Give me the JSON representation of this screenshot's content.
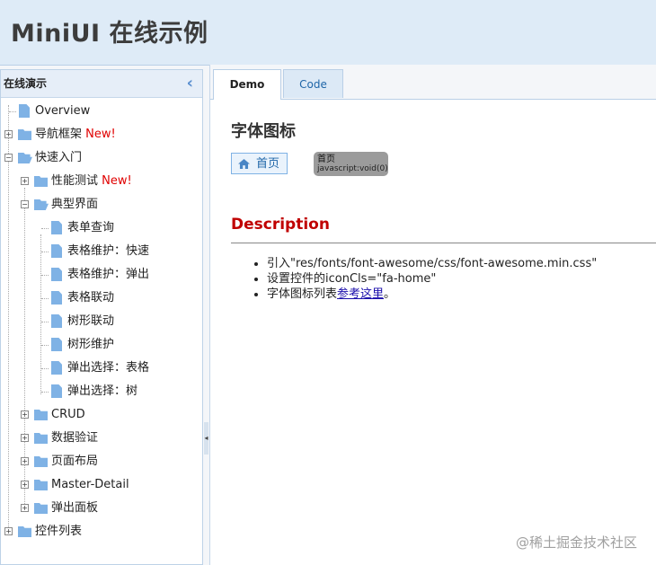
{
  "app": {
    "title": "MiniUI 在线示例"
  },
  "sidebar": {
    "title": "在线演示",
    "collapse_glyph": "‹",
    "nodes": [
      {
        "label": "Overview",
        "new": ""
      },
      {
        "label": "导航框架",
        "new": "New!"
      },
      {
        "label": "快速入门",
        "new": ""
      },
      {
        "label": "性能测试",
        "new": "New!"
      },
      {
        "label": "典型界面",
        "new": ""
      },
      {
        "label": "表单查询",
        "new": ""
      },
      {
        "label": "表格维护：快速",
        "new": ""
      },
      {
        "label": "表格维护：弹出",
        "new": ""
      },
      {
        "label": "表格联动",
        "new": ""
      },
      {
        "label": "树形联动",
        "new": ""
      },
      {
        "label": "树形维护",
        "new": ""
      },
      {
        "label": "弹出选择：表格",
        "new": ""
      },
      {
        "label": "弹出选择：树",
        "new": ""
      },
      {
        "label": "CRUD",
        "new": ""
      },
      {
        "label": "数据验证",
        "new": ""
      },
      {
        "label": "页面布局",
        "new": ""
      },
      {
        "label": "Master-Detail",
        "new": ""
      },
      {
        "label": "弹出面板",
        "new": ""
      },
      {
        "label": "控件列表",
        "new": ""
      }
    ]
  },
  "tabs": [
    {
      "label": "Demo",
      "active": true
    },
    {
      "label": "Code",
      "active": false
    }
  ],
  "content": {
    "section_title": "字体图标",
    "home_button": "首页",
    "tooltip": {
      "title": "首页",
      "subtitle": "javascript:void(0)"
    },
    "description_title": "Description",
    "items": [
      {
        "text": "引入\"res/fonts/font-awesome/css/font-awesome.min.css\""
      },
      {
        "text": "设置控件的iconCls=\"fa-home\""
      },
      {
        "text": "字体图标列表",
        "link": "参考这里",
        "after": "。"
      }
    ]
  },
  "watermark": "@稀土掘金技术社区",
  "colors": {
    "accent": "#7fb2e5",
    "new_tag": "#e00000",
    "description": "#c00000",
    "header_bg": "#deebf7"
  }
}
